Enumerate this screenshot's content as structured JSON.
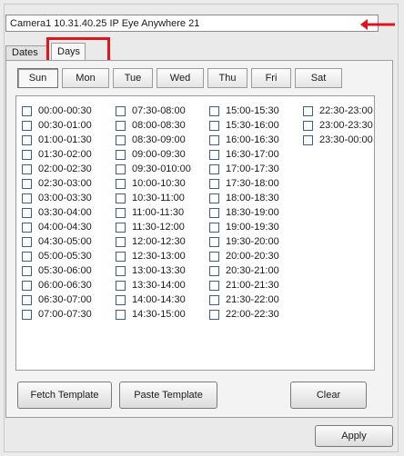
{
  "camera": {
    "label": "Camera1 10.31.40.25 IP Eye Anywhere 21"
  },
  "tabs": [
    {
      "label": "Dates"
    },
    {
      "label": "Days"
    }
  ],
  "days": [
    {
      "label": "Sun"
    },
    {
      "label": "Mon"
    },
    {
      "label": "Tue"
    },
    {
      "label": "Wed"
    },
    {
      "label": "Thu"
    },
    {
      "label": "Fri"
    },
    {
      "label": "Sat"
    }
  ],
  "selected_day": "Sun",
  "active_tab": "Days",
  "slots": [
    [
      "00:00-00:30",
      "00:30-01:00",
      "01:00-01:30",
      "01:30-02:00",
      "02:00-02:30",
      "02:30-03:00",
      "03:00-03:30",
      "03:30-04:00",
      "04:00-04:30",
      "04:30-05:00",
      "05:00-05:30",
      "05:30-06:00",
      "06:00-06:30",
      "06:30-07:00",
      "07:00-07:30"
    ],
    [
      "07:30-08:00",
      "08:00-08:30",
      "08:30-09:00",
      "09:00-09:30",
      "09:30-010:00",
      "10:00-10:30",
      "10:30-11:00",
      "11:00-11:30",
      "11:30-12:00",
      "12:00-12:30",
      "12:30-13:00",
      "13:00-13:30",
      "13:30-14:00",
      "14:00-14:30",
      "14:30-15:00"
    ],
    [
      "15:00-15:30",
      "15:30-16:00",
      "16:00-16:30",
      "16:30-17:00",
      "17:00-17:30",
      "17:30-18:00",
      "18:00-18:30",
      "18:30-19:00",
      "19:00-19:30",
      "19:30-20:00",
      "20:00-20:30",
      "20:30-21:00",
      "21:00-21:30",
      "21:30-22:00",
      "22:00-22:30"
    ],
    [
      "22:30-23:00",
      "23:00-23:30",
      "23:30-00:00"
    ]
  ],
  "buttons": {
    "fetch_label": "Fetch Template",
    "paste_label": "Paste Template",
    "clear_label": "Clear",
    "apply_label": "Apply"
  },
  "colors": {
    "highlight": "#e0141d",
    "arrow": "#e0141d"
  }
}
